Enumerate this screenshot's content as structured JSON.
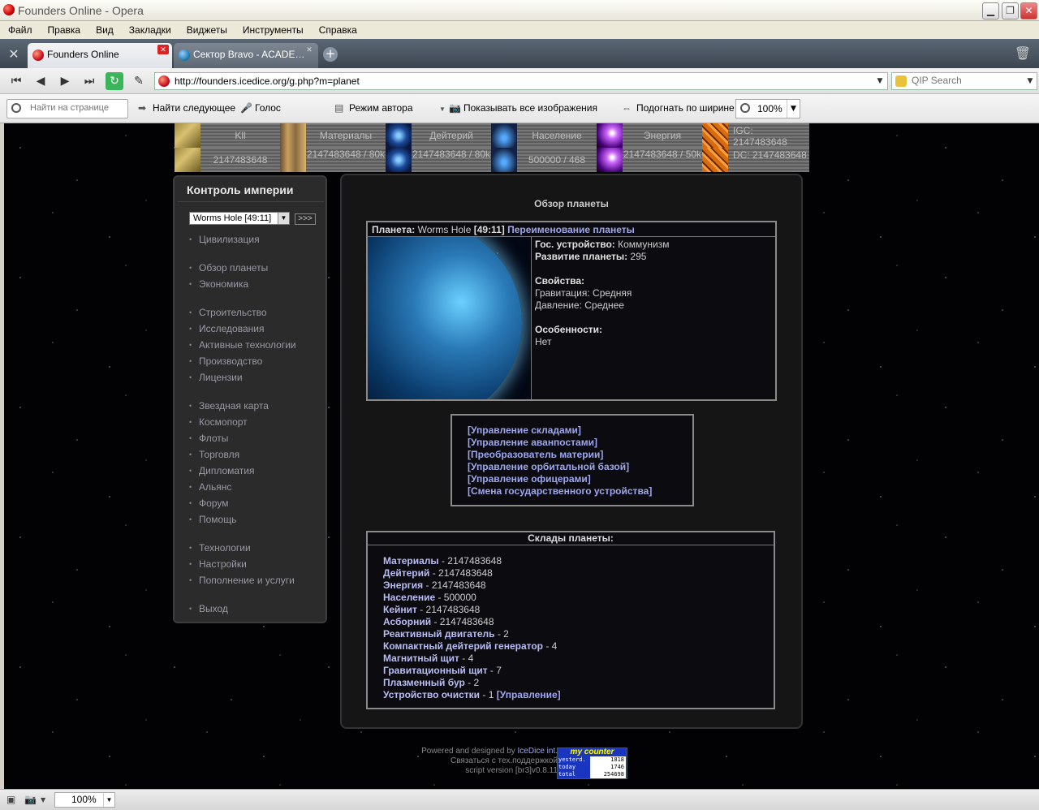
{
  "window": {
    "title": "Founders Online - Opera"
  },
  "menu": [
    "Файл",
    "Правка",
    "Вид",
    "Закладки",
    "Виджеты",
    "Инструменты",
    "Справка"
  ],
  "tabs": [
    {
      "label": "Founders Online",
      "active": true
    },
    {
      "label": "Сектор Bravo - ACADE…",
      "active": false
    }
  ],
  "address": {
    "url": "http://founders.icedice.org/g.php?m=planet",
    "search_placeholder": "QIP Search"
  },
  "findbar": {
    "placeholder": "Найти на странице",
    "find_next": "Найти следующее",
    "voice": "Голос",
    "author_mode": "Режим автора",
    "show_images": "Показывать все изображения",
    "fit_width": "Подогнать по ширине",
    "zoom": "100%"
  },
  "resources": [
    {
      "label": "Kll",
      "value": "2147483648",
      "icon": "money-icon"
    },
    {
      "label": "Материалы",
      "value": "2147483648 / 80k",
      "icon": "materials-icon"
    },
    {
      "label": "Дейтерий",
      "value": "2147483648 / 80k",
      "icon": "deuterium-icon"
    },
    {
      "label": "Население",
      "value": "500000 / 468",
      "icon": "population-icon"
    },
    {
      "label": "Энергия",
      "value": "2147483648 / 50k",
      "icon": "energy-icon"
    },
    {
      "label": "IGC: 2147483648",
      "value": "DC: 2147483648",
      "icon": "igc-icon"
    }
  ],
  "sidebar": {
    "title": "Контроль империи",
    "planet_select": "Worms Hole [49:11]",
    "go_button": ">>>",
    "groups": [
      [
        "Цивилизация"
      ],
      [
        "Обзор планеты",
        "Экономика"
      ],
      [
        "Строительство",
        "Исследования",
        "Активные технологии",
        "Производство",
        "Лицензии"
      ],
      [
        "Звездная карта",
        "Космопорт",
        "Флоты",
        "Торговля",
        "Дипломатия",
        "Альянс",
        "Форум",
        "Помощь"
      ],
      [
        "Технологии",
        "Настройки",
        "Пополнение и услуги"
      ],
      [
        "Выход"
      ]
    ]
  },
  "main": {
    "title": "Обзор планеты",
    "planet": {
      "label": "Планета:",
      "name": "Worms Hole",
      "coords": "[49:11]",
      "rename_link": "Переименование планеты",
      "gov_label": "Гос. устройство:",
      "gov_value": "Коммунизм",
      "dev_label": "Развитие планеты:",
      "dev_value": "295",
      "props_label": "Свойства:",
      "gravity": "Гравитация: Средняя",
      "pressure": "Давление: Среднее",
      "features_label": "Особенности:",
      "features_value": "Нет"
    },
    "links": [
      "[Управление складами]",
      "[Управление аванпостами]",
      "[Преобразователь материи]",
      "[Управление орбитальной базой]",
      "[Управление офицерами]",
      "[Смена государственного устройства]"
    ],
    "storage": {
      "title": "Склады планеты:",
      "items": [
        {
          "name": "Материалы",
          "value": " - 2147483648"
        },
        {
          "name": "Дейтерий",
          "value": " - 2147483648"
        },
        {
          "name": "Энергия",
          "value": " - 2147483648"
        },
        {
          "name": "Население",
          "value": " - 500000"
        },
        {
          "name": "Кейнит",
          "value": " - 2147483648"
        },
        {
          "name": "Асборний",
          "value": " - 2147483648"
        },
        {
          "name": "Реактивный двигатель",
          "value": " - 2"
        },
        {
          "name": "Компактный дейтерий генератор",
          "value": " - 4"
        },
        {
          "name": "Магнитный щит",
          "value": " - 4"
        },
        {
          "name": "Гравитационный щит",
          "value": " - 7"
        },
        {
          "name": "Плазменный бур",
          "value": " - 2"
        },
        {
          "name": "Устройство очистки",
          "value": " - 1 "
        }
      ],
      "manage_link": "[Управление]"
    }
  },
  "footer": {
    "line1_prefix": "Powered and designed by ",
    "line1_link": "IceDice int.",
    "line2": "Связаться с тех.поддержкой",
    "line3": "script version [br3]v0.8.11",
    "counter": {
      "title": "my counter",
      "rows": [
        {
          "label": "yesterd.",
          "value": "1818"
        },
        {
          "label": "today",
          "value": "1746"
        },
        {
          "label": "total",
          "value": "254698"
        }
      ]
    }
  },
  "statusbar": {
    "zoom": "100%"
  }
}
